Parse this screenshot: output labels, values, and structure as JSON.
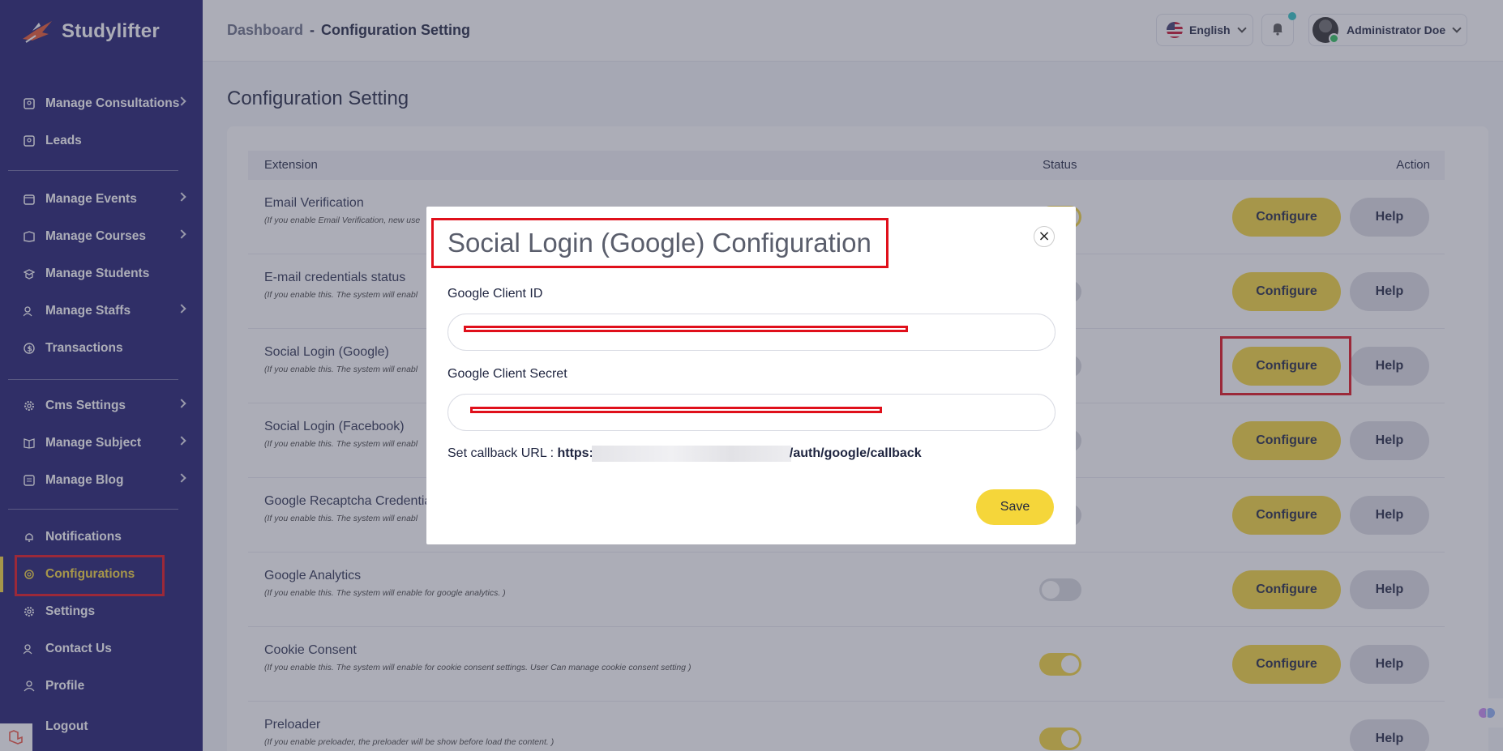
{
  "brand": {
    "name": "Studylifter"
  },
  "sidebar": {
    "items": [
      {
        "label": "Manage Consultations",
        "icon": "consultation-icon",
        "chevron": true
      },
      {
        "label": "Leads",
        "icon": "leads-icon",
        "chevron": false
      },
      {
        "label": "Manage Events",
        "icon": "calendar-icon",
        "chevron": true
      },
      {
        "label": "Manage Courses",
        "icon": "courses-icon",
        "chevron": true
      },
      {
        "label": "Manage Students",
        "icon": "students-icon",
        "chevron": false
      },
      {
        "label": "Manage Staffs",
        "icon": "staffs-icon",
        "chevron": true
      },
      {
        "label": "Transactions",
        "icon": "transactions-icon",
        "chevron": false
      },
      {
        "label": "Cms Settings",
        "icon": "gear-icon",
        "chevron": true
      },
      {
        "label": "Manage Subject",
        "icon": "book-icon",
        "chevron": true
      },
      {
        "label": "Manage Blog",
        "icon": "blog-icon",
        "chevron": true
      },
      {
        "label": "Notifications",
        "icon": "bell-icon",
        "chevron": false
      },
      {
        "label": "Configurations",
        "icon": "configuration-icon",
        "chevron": false,
        "active": true
      },
      {
        "label": "Settings",
        "icon": "settings-icon",
        "chevron": false
      },
      {
        "label": "Contact Us",
        "icon": "contact-icon",
        "chevron": false
      },
      {
        "label": "Profile",
        "icon": "profile-icon",
        "chevron": false
      },
      {
        "label": "Logout",
        "icon": "logout-icon",
        "chevron": false
      }
    ]
  },
  "header": {
    "breadcrumb_root": "Dashboard",
    "breadcrumb_sep": "-",
    "breadcrumb_current": "Configuration Setting",
    "language": "English",
    "user_name": "Administrator Doe"
  },
  "main": {
    "title": "Configuration Setting",
    "columns": {
      "extension": "Extension",
      "status": "Status",
      "action": "Action"
    },
    "configure_label": "Configure",
    "help_label": "Help",
    "rows": [
      {
        "name": "Email Verification",
        "desc": "(If you enable Email Verification, new use",
        "enabled": true,
        "configure": true
      },
      {
        "name": "E-mail credentials status",
        "desc": "(If you enable this. The system will enabl",
        "enabled": false,
        "configure": true
      },
      {
        "name": "Social Login (Google)",
        "desc": "(If you enable this. The system will enabl",
        "enabled": false,
        "configure": true
      },
      {
        "name": "Social Login (Facebook)",
        "desc": "(If you enable this. The system will enabl",
        "enabled": false,
        "configure": true
      },
      {
        "name": "Google Recaptcha Credentia",
        "desc": "(If you enable this. The system will enabl",
        "enabled": false,
        "configure": true
      },
      {
        "name": "Google Analytics",
        "desc": "(If you enable this. The system will enable for google analytics. )",
        "enabled": false,
        "configure": true
      },
      {
        "name": "Cookie Consent",
        "desc": "(If you enable this. The system will enable for cookie consent settings. User Can manage cookie consent setting )",
        "enabled": true,
        "configure": true
      },
      {
        "name": "Preloader",
        "desc": "(If you enable preloader, the preloader will be show before load the content. )",
        "enabled": true,
        "configure": false
      }
    ]
  },
  "modal": {
    "title": "Social Login (Google) Configuration",
    "close_glyph": "×",
    "client_id_label": "Google Client ID",
    "client_id_value": "",
    "client_secret_label": "Google Client Secret",
    "client_secret_value": "",
    "callback_label": "Set callback URL :",
    "callback_prefix": "https:",
    "callback_suffix": "/auth/google/callback",
    "save_label": "Save"
  },
  "colors": {
    "sidebar": "#1e1b6e",
    "accent": "#f5d63a",
    "highlight": "#e0101b"
  }
}
